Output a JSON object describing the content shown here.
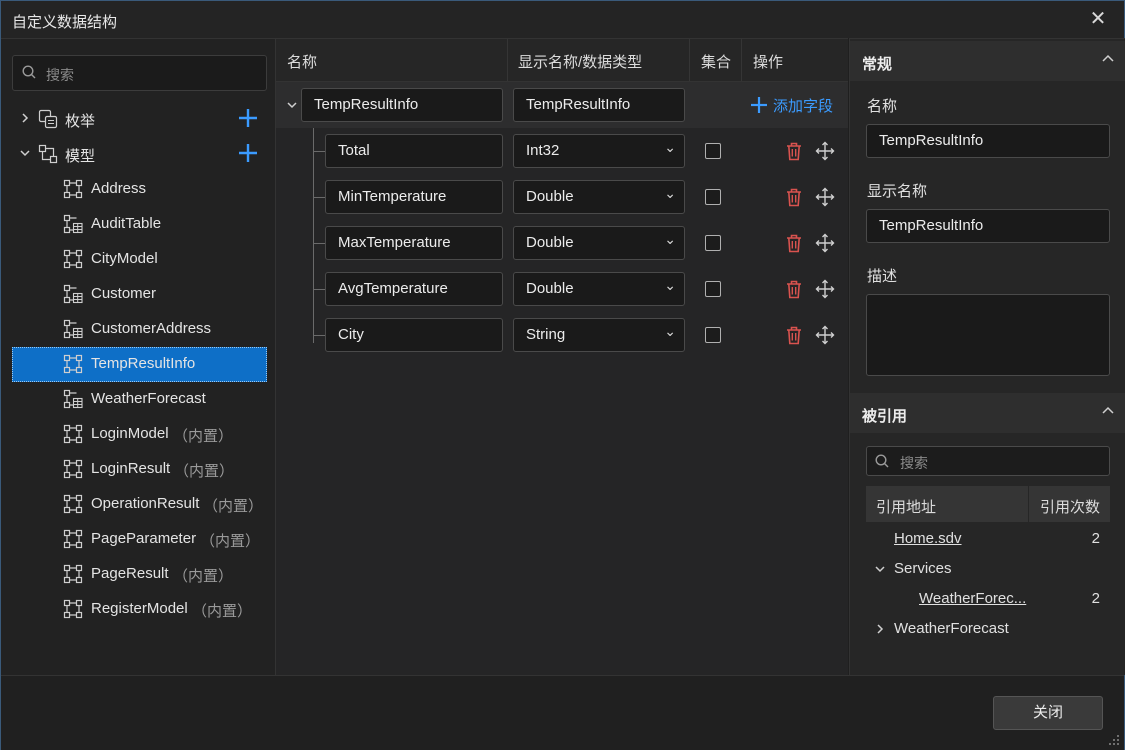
{
  "window": {
    "title": "自定义数据结构"
  },
  "sidebar": {
    "search_placeholder": "搜索",
    "groups": [
      {
        "label": "枚举"
      },
      {
        "label": "模型"
      }
    ],
    "models": [
      {
        "label": "Address",
        "suffix": ""
      },
      {
        "label": "AuditTable",
        "suffix": ""
      },
      {
        "label": "CityModel",
        "suffix": ""
      },
      {
        "label": "Customer",
        "suffix": ""
      },
      {
        "label": "CustomerAddress",
        "suffix": ""
      },
      {
        "label": "TempResultInfo",
        "suffix": ""
      },
      {
        "label": "WeatherForecast",
        "suffix": ""
      },
      {
        "label": "LoginModel",
        "suffix": "（内置）"
      },
      {
        "label": "LoginResult",
        "suffix": "（内置）"
      },
      {
        "label": "OperationResult",
        "suffix": "（内置）"
      },
      {
        "label": "PageParameter",
        "suffix": "（内置）"
      },
      {
        "label": "PageResult",
        "suffix": "（内置）"
      },
      {
        "label": "RegisterModel",
        "suffix": "（内置）"
      }
    ],
    "selected_index": 5
  },
  "grid": {
    "headers": {
      "name": "名称",
      "display": "显示名称/数据类型",
      "collection": "集合",
      "actions": "操作"
    },
    "root": {
      "name": "TempResultInfo",
      "display": "TempResultInfo",
      "add_label": "添加字段"
    },
    "fields": [
      {
        "name": "Total",
        "type": "Int32",
        "collection": false
      },
      {
        "name": "MinTemperature",
        "type": "Double",
        "collection": false
      },
      {
        "name": "MaxTemperature",
        "type": "Double",
        "collection": false
      },
      {
        "name": "AvgTemperature",
        "type": "Double",
        "collection": false
      },
      {
        "name": "City",
        "type": "String",
        "collection": false
      }
    ]
  },
  "properties": {
    "general_title": "常规",
    "name_label": "名称",
    "name_value": "TempResultInfo",
    "display_label": "显示名称",
    "display_value": "TempResultInfo",
    "desc_label": "描述",
    "desc_value": ""
  },
  "references": {
    "title": "被引用",
    "search_placeholder": "搜索",
    "col_address": "引用地址",
    "col_count": "引用次数",
    "rows": [
      {
        "label": "Home.sdv",
        "count": "2"
      },
      {
        "label": "Services",
        "count": ""
      },
      {
        "label": "WeatherForec...",
        "count": "2"
      },
      {
        "label": "WeatherForecast",
        "count": ""
      }
    ]
  },
  "footer": {
    "close_label": "关闭"
  },
  "colors": {
    "accent": "#0e6fc7",
    "link": "#3b9bff",
    "delete": "#d9534f"
  }
}
